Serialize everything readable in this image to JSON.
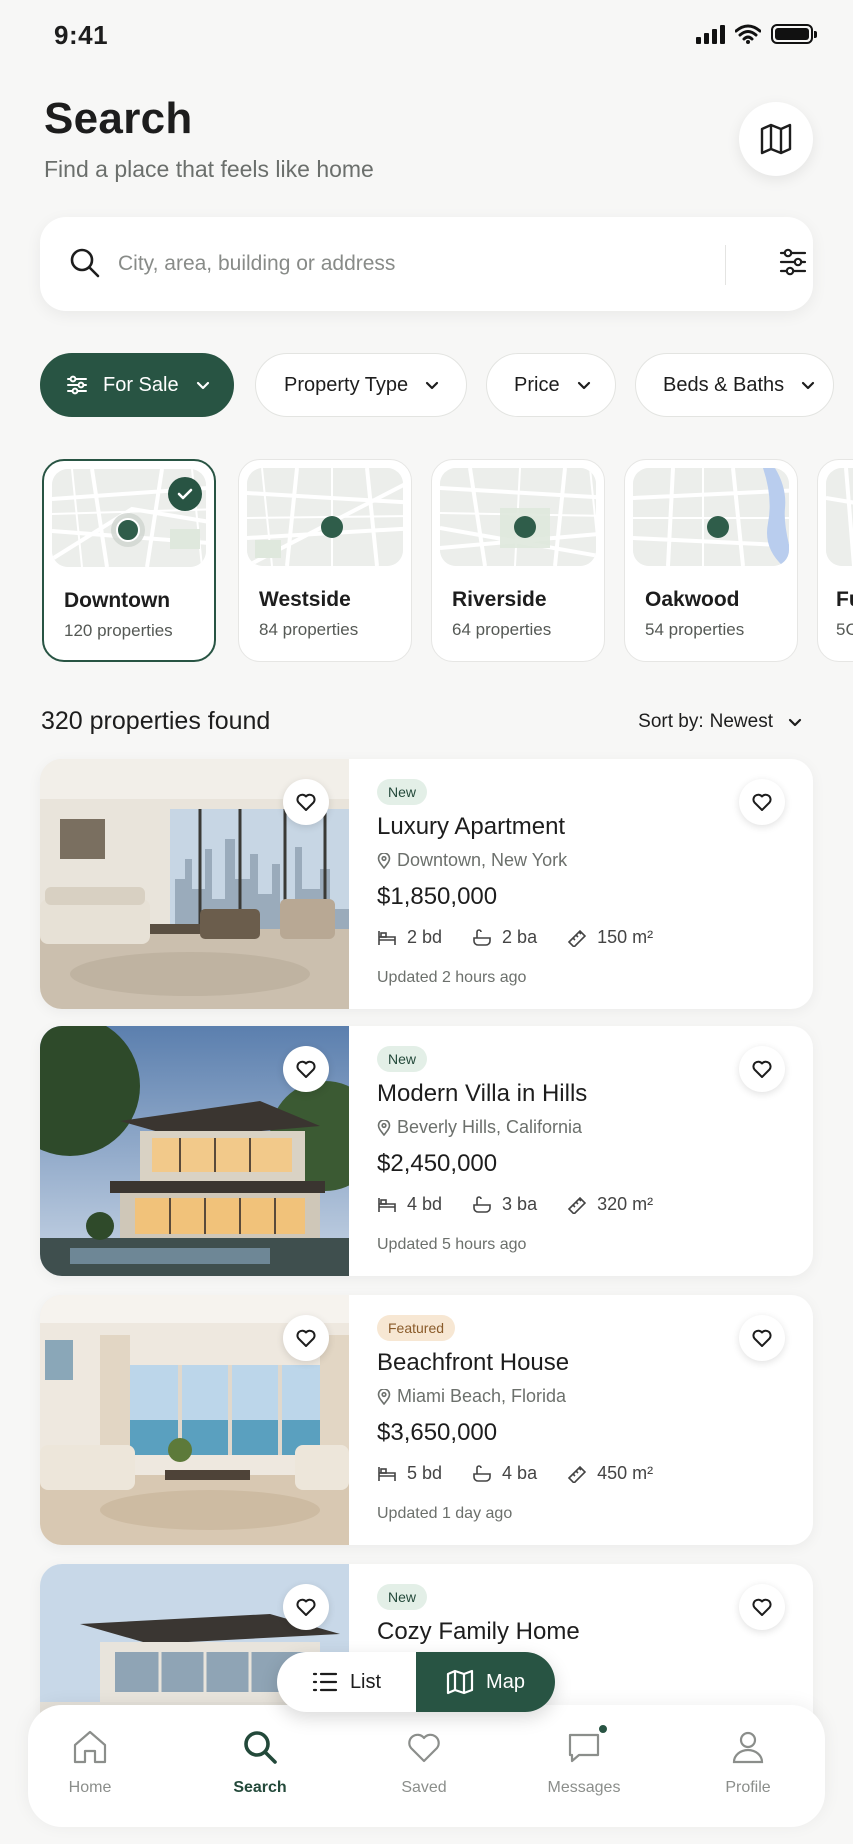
{
  "status_bar": {
    "time": "9:41"
  },
  "header": {
    "title": "Search",
    "subtitle": "Find a place that feels like home",
    "map_icon": "map-icon"
  },
  "search": {
    "placeholder": "City, area, building or address",
    "value": "",
    "filter_icon": "sliders-icon"
  },
  "filters": [
    {
      "label": "For Sale",
      "active": true
    },
    {
      "label": "Property Type",
      "active": false
    },
    {
      "label": "Price",
      "active": false
    },
    {
      "label": "Beds & Baths",
      "active": false
    }
  ],
  "areas": [
    {
      "name": "Downtown",
      "count": "120 properties",
      "selected": true
    },
    {
      "name": "Westside",
      "count": "84 properties",
      "selected": false
    },
    {
      "name": "Riverside",
      "count": "64 properties",
      "selected": false
    },
    {
      "name": "Oakwood",
      "count": "54 properties",
      "selected": false
    },
    {
      "name": "Fu",
      "count": "5C",
      "selected": false
    }
  ],
  "results": {
    "count": "320 properties found",
    "sort_label": "Sort by:",
    "sort_value": "Newest"
  },
  "listings": [
    {
      "badge": "New",
      "title": "Luxury Apartment",
      "location": "Downtown, New York",
      "price": "$1,850,000",
      "beds": "2 bd",
      "baths": "2 ba",
      "area": "150 m²",
      "updated": "Updated 2 hours ago"
    },
    {
      "badge": "New",
      "title": "Modern Villa in Hills",
      "location": "Beverly Hills, California",
      "price": "$2,450,000",
      "beds": "4 bd",
      "baths": "3 ba",
      "area": "320 m²",
      "updated": "Updated 5 hours ago"
    },
    {
      "badge": "Featured",
      "title": "Beachfront House",
      "location": "Miami Beach, Florida",
      "price": "$3,650,000",
      "beds": "5 bd",
      "baths": "4 ba",
      "area": "450 m²",
      "updated": "Updated 1 day ago"
    },
    {
      "badge": "New",
      "title": "Cozy Family Home"
    }
  ],
  "view_toggle": {
    "list_label": "List",
    "map_label": "Map",
    "active": "Map"
  },
  "bottom_nav": [
    {
      "label": "Home",
      "icon": "home-icon",
      "active": false
    },
    {
      "label": "Search",
      "icon": "search-icon",
      "active": true
    },
    {
      "label": "Saved",
      "icon": "heart-icon",
      "active": false
    },
    {
      "label": "Messages",
      "icon": "chat-icon",
      "active": false,
      "notification_dot": true
    },
    {
      "label": "Profile",
      "icon": "user-icon",
      "active": false
    }
  ],
  "colors": {
    "accent": "#285443",
    "background": "#f7f7f6",
    "badge_new_bg": "#e3efe7",
    "badge_featured_bg": "#f7e7d3"
  }
}
